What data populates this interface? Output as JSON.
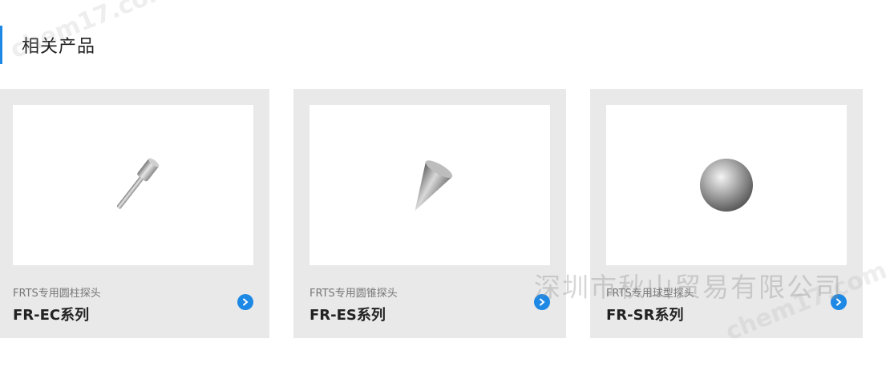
{
  "section": {
    "title": "相关产品"
  },
  "products": [
    {
      "subtitle": "FRTS专用圆柱探头",
      "name": "FR-EC系列",
      "image_icon": "cylinder-probe-tip-icon"
    },
    {
      "subtitle": "FRTS专用圆锥探头",
      "name": "FR-ES系列",
      "image_icon": "cone-probe-tip-icon"
    },
    {
      "subtitle": "FRTS专用球型探头",
      "name": "FR-SR系列",
      "image_icon": "sphere-probe-tip-icon"
    }
  ],
  "watermarks": {
    "company": "深圳市秋山贸易有限公司",
    "site": "chem17.com"
  },
  "colors": {
    "accent": "#1e88e5",
    "card_bg": "#e9e9e9"
  }
}
